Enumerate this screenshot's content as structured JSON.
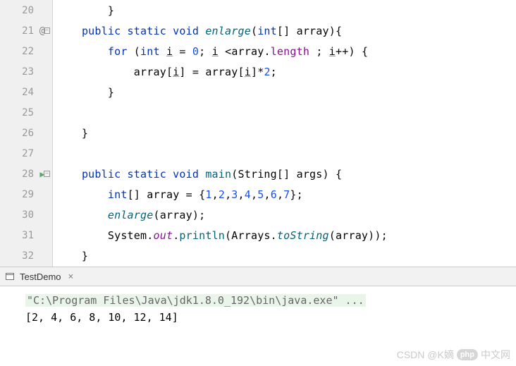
{
  "lines": [
    {
      "n": "20",
      "icon": "",
      "fold": "",
      "tokens": [
        {
          "t": "        }",
          "c": ""
        }
      ]
    },
    {
      "n": "21",
      "icon": "@",
      "fold": "minus",
      "tokens": [
        {
          "t": "    ",
          "c": ""
        },
        {
          "t": "public static void ",
          "c": "kw"
        },
        {
          "t": "enlarge",
          "c": "fn"
        },
        {
          "t": "(",
          "c": ""
        },
        {
          "t": "int",
          "c": "kw"
        },
        {
          "t": "[] ",
          "c": ""
        },
        {
          "t": "array",
          "c": "var"
        },
        {
          "t": "){",
          "c": ""
        }
      ]
    },
    {
      "n": "22",
      "icon": "",
      "fold": "",
      "tokens": [
        {
          "t": "        ",
          "c": ""
        },
        {
          "t": "for ",
          "c": "kw"
        },
        {
          "t": "(",
          "c": ""
        },
        {
          "t": "int ",
          "c": "kw"
        },
        {
          "t": "i",
          "c": "u"
        },
        {
          "t": " = ",
          "c": ""
        },
        {
          "t": "0",
          "c": "num"
        },
        {
          "t": "; ",
          "c": ""
        },
        {
          "t": "i",
          "c": "u"
        },
        {
          "t": " <",
          "c": ""
        },
        {
          "t": "array",
          "c": "var"
        },
        {
          "t": ".",
          "c": ""
        },
        {
          "t": "length ",
          "c": "fld"
        },
        {
          "t": "; ",
          "c": ""
        },
        {
          "t": "i",
          "c": "u"
        },
        {
          "t": "++) {",
          "c": ""
        }
      ]
    },
    {
      "n": "23",
      "icon": "",
      "fold": "",
      "tokens": [
        {
          "t": "            ",
          "c": ""
        },
        {
          "t": "array",
          "c": "var"
        },
        {
          "t": "[",
          "c": ""
        },
        {
          "t": "i",
          "c": "u"
        },
        {
          "t": "] = ",
          "c": ""
        },
        {
          "t": "array",
          "c": "var"
        },
        {
          "t": "[",
          "c": ""
        },
        {
          "t": "i",
          "c": "u"
        },
        {
          "t": "]*",
          "c": ""
        },
        {
          "t": "2",
          "c": "num"
        },
        {
          "t": ";",
          "c": ""
        }
      ]
    },
    {
      "n": "24",
      "icon": "",
      "fold": "",
      "tokens": [
        {
          "t": "        }",
          "c": ""
        }
      ]
    },
    {
      "n": "25",
      "icon": "",
      "fold": "",
      "tokens": [
        {
          "t": "",
          "c": ""
        }
      ]
    },
    {
      "n": "26",
      "icon": "",
      "fold": "",
      "tokens": [
        {
          "t": "    }",
          "c": ""
        }
      ]
    },
    {
      "n": "27",
      "icon": "",
      "fold": "",
      "tokens": [
        {
          "t": "",
          "c": ""
        }
      ]
    },
    {
      "n": "28",
      "icon": "run",
      "fold": "minus",
      "tokens": [
        {
          "t": "    ",
          "c": ""
        },
        {
          "t": "public static void ",
          "c": "kw"
        },
        {
          "t": "main",
          "c": "fn2"
        },
        {
          "t": "(",
          "c": ""
        },
        {
          "t": "String",
          "c": "type"
        },
        {
          "t": "[] ",
          "c": ""
        },
        {
          "t": "args",
          "c": "var"
        },
        {
          "t": ") {",
          "c": ""
        }
      ]
    },
    {
      "n": "29",
      "icon": "",
      "fold": "",
      "tokens": [
        {
          "t": "        ",
          "c": ""
        },
        {
          "t": "int",
          "c": "kw"
        },
        {
          "t": "[] ",
          "c": ""
        },
        {
          "t": "array",
          "c": "var"
        },
        {
          "t": " = {",
          "c": ""
        },
        {
          "t": "1",
          "c": "num"
        },
        {
          "t": ",",
          "c": ""
        },
        {
          "t": "2",
          "c": "num"
        },
        {
          "t": ",",
          "c": ""
        },
        {
          "t": "3",
          "c": "num"
        },
        {
          "t": ",",
          "c": ""
        },
        {
          "t": "4",
          "c": "num"
        },
        {
          "t": ",",
          "c": ""
        },
        {
          "t": "5",
          "c": "num"
        },
        {
          "t": ",",
          "c": ""
        },
        {
          "t": "6",
          "c": "num"
        },
        {
          "t": ",",
          "c": ""
        },
        {
          "t": "7",
          "c": "num"
        },
        {
          "t": "};",
          "c": ""
        }
      ]
    },
    {
      "n": "30",
      "icon": "",
      "fold": "",
      "tokens": [
        {
          "t": "        ",
          "c": ""
        },
        {
          "t": "enlarge",
          "c": "fn"
        },
        {
          "t": "(",
          "c": ""
        },
        {
          "t": "array",
          "c": "var"
        },
        {
          "t": ");",
          "c": ""
        }
      ]
    },
    {
      "n": "31",
      "icon": "",
      "fold": "",
      "tokens": [
        {
          "t": "        ",
          "c": ""
        },
        {
          "t": "System",
          "c": "type"
        },
        {
          "t": ".",
          "c": ""
        },
        {
          "t": "out",
          "c": "fld-i"
        },
        {
          "t": ".",
          "c": ""
        },
        {
          "t": "println",
          "c": "fn2"
        },
        {
          "t": "(",
          "c": ""
        },
        {
          "t": "Arrays",
          "c": "type"
        },
        {
          "t": ".",
          "c": ""
        },
        {
          "t": "toString",
          "c": "fn"
        },
        {
          "t": "(",
          "c": ""
        },
        {
          "t": "array",
          "c": "var"
        },
        {
          "t": "));",
          "c": ""
        }
      ]
    },
    {
      "n": "32",
      "icon": "",
      "fold": "",
      "tokens": [
        {
          "t": "    }",
          "c": ""
        }
      ]
    }
  ],
  "tab": {
    "label": "TestDemo",
    "close": "×"
  },
  "console": {
    "line1": "\"C:\\Program Files\\Java\\jdk1.8.0_192\\bin\\java.exe\" ...",
    "line2": "[2, 4, 6, 8, 10, 12, 14]"
  },
  "watermark": {
    "php": "php",
    "text": "中文网",
    "csdn": "CSDN @K嫡"
  }
}
